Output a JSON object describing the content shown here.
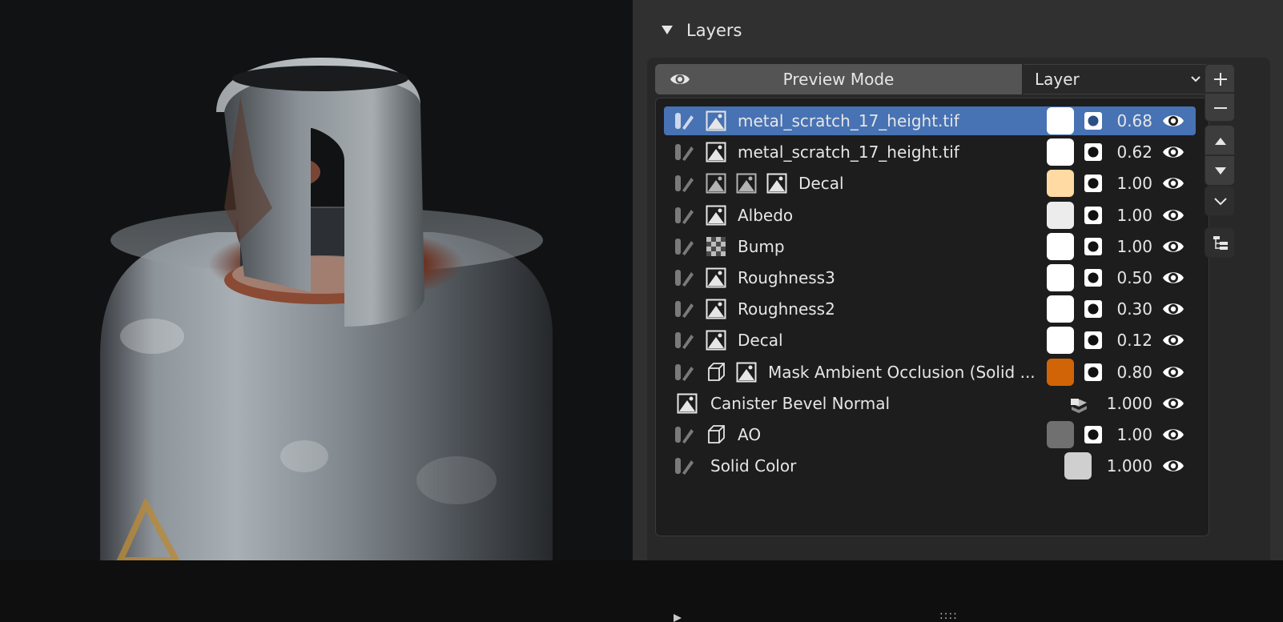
{
  "panel": {
    "title": "Layers",
    "preview_mode_label": "Preview Mode",
    "layer_select_value": "Layer"
  },
  "layers": [
    {
      "name": "metal_scratch_17_height.tif",
      "value": "0.68",
      "swatch": "#ffffff",
      "selected": true,
      "icons": [
        "paint-icon",
        "image-icon"
      ]
    },
    {
      "name": "metal_scratch_17_height.tif",
      "value": "0.62",
      "swatch": "#ffffff",
      "selected": false,
      "icons": [
        "paint-icon",
        "image-icon"
      ]
    },
    {
      "name": "Decal",
      "value": "1.00",
      "swatch": "#ffdaa3",
      "selected": false,
      "icons": [
        "paint-icon",
        "image-icon",
        "image-icon",
        "image-icon"
      ]
    },
    {
      "name": "Albedo",
      "value": "1.00",
      "swatch": "#ececec",
      "selected": false,
      "icons": [
        "paint-icon",
        "image-icon"
      ]
    },
    {
      "name": "Bump",
      "value": "1.00",
      "swatch": "#ffffff",
      "selected": false,
      "icons": [
        "paint-icon",
        "checker-icon"
      ]
    },
    {
      "name": "Roughness3",
      "value": "0.50",
      "swatch": "#ffffff",
      "selected": false,
      "icons": [
        "paint-icon",
        "image-icon"
      ]
    },
    {
      "name": "Roughness2",
      "value": "0.30",
      "swatch": "#ffffff",
      "selected": false,
      "icons": [
        "paint-icon",
        "image-icon"
      ]
    },
    {
      "name": "Decal",
      "value": "0.12",
      "swatch": "#ffffff",
      "selected": false,
      "icons": [
        "paint-icon",
        "image-icon"
      ]
    },
    {
      "name": "Mask Ambient Occlusion (Solid ...",
      "value": "0.80",
      "swatch": "#d06407",
      "selected": false,
      "icons": [
        "paint-icon",
        "cube-icon",
        "image-icon"
      ]
    },
    {
      "name": "Canister Bevel Normal",
      "value": "1.000",
      "swatch": null,
      "selected": false,
      "icons": [
        "image-icon"
      ],
      "trailing_icon": "layers-stack-icon"
    },
    {
      "name": "AO",
      "value": "1.00",
      "swatch": "#707070",
      "selected": false,
      "icons": [
        "paint-icon",
        "cube-icon"
      ]
    },
    {
      "name": "Solid Color",
      "value": "1.000",
      "swatch": "#cfcfcf",
      "selected": false,
      "icons": [
        "paint-icon"
      ]
    }
  ],
  "footer": {
    "grip": "::::"
  },
  "side_buttons": [
    "add-icon",
    "remove-icon",
    "move-up-icon",
    "move-down-icon",
    "chevron-down-icon",
    "outliner-icon"
  ],
  "colors": {
    "selection": "#4772b3",
    "panel": "#303030",
    "list": "#1d1d1d",
    "viewport": "#111213"
  }
}
